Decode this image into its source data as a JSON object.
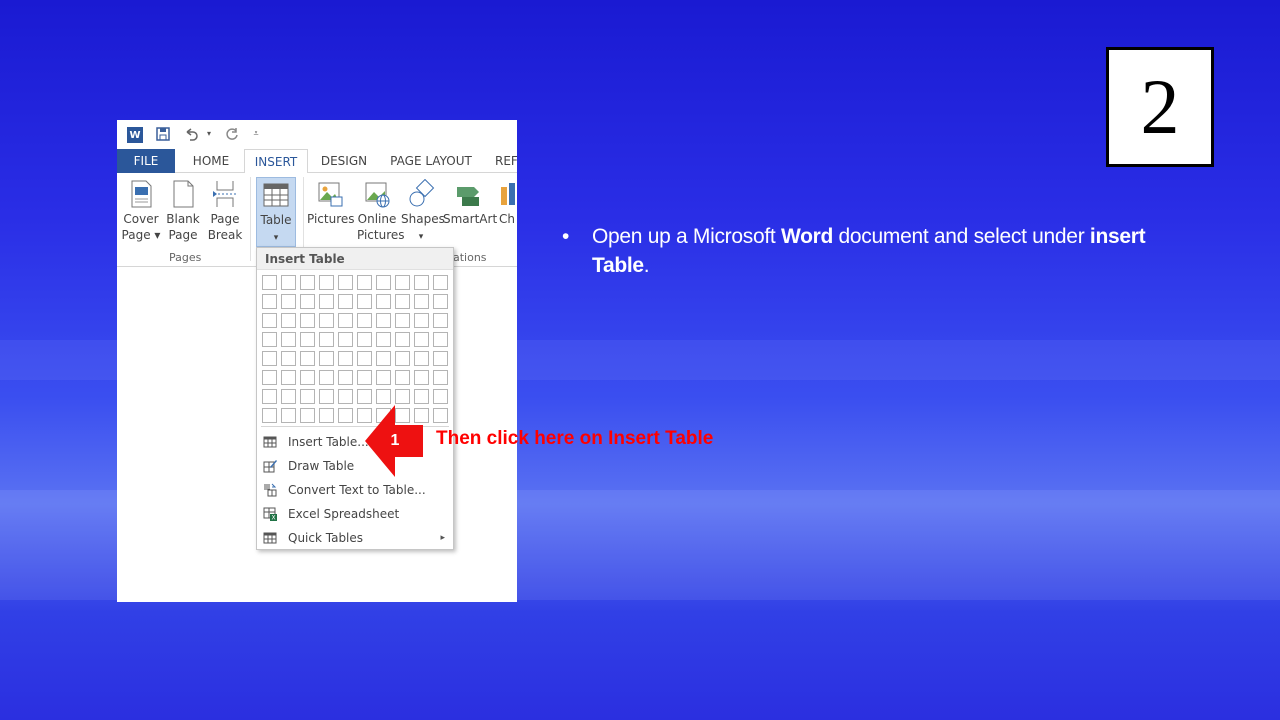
{
  "slide": {
    "number": "2",
    "bullet_symbol": "•",
    "bullet_parts": [
      "Open up a Microsoft ",
      "Word",
      " document and select under ",
      "insert",
      " Table",
      "."
    ],
    "callout_number": "1",
    "callout_text": "Then click here on Insert Table"
  },
  "word": {
    "qat": {
      "app_icon_letter": "W"
    },
    "tabs": [
      "FILE",
      "HOME",
      "INSERT",
      "DESIGN",
      "PAGE LAYOUT",
      "REF"
    ],
    "ribbon": {
      "cover_page": [
        "Cover",
        "Page ▾"
      ],
      "blank_page": [
        "Blank",
        "Page"
      ],
      "page_break": [
        "Page",
        "Break"
      ],
      "pages_group": "Pages",
      "table": [
        "Table",
        "▾"
      ],
      "pictures": "Pictures",
      "online_pictures": [
        "Online",
        "Pictures"
      ],
      "shapes": [
        "Shapes",
        "▾"
      ],
      "smartart": "SmartArt",
      "chart_partial": "Ch",
      "illustrations_partial": "ations"
    },
    "dropdown": {
      "header": "Insert Table",
      "grid_cols": 10,
      "grid_rows": 8,
      "items": [
        {
          "label": "Insert Table...",
          "icon": "table-grid-icon"
        },
        {
          "label": "Draw Table",
          "icon": "pencil-table-icon"
        },
        {
          "label": "Convert Text to Table...",
          "icon": "convert-text-icon"
        },
        {
          "label": "Excel Spreadsheet",
          "icon": "excel-icon"
        },
        {
          "label": "Quick Tables",
          "icon": "table-grid-icon",
          "submenu": "▸"
        }
      ]
    }
  },
  "colors": {
    "word_blue": "#2b579a",
    "callout_red": "#ff0000",
    "bg_blue": "#2a2ee6"
  }
}
